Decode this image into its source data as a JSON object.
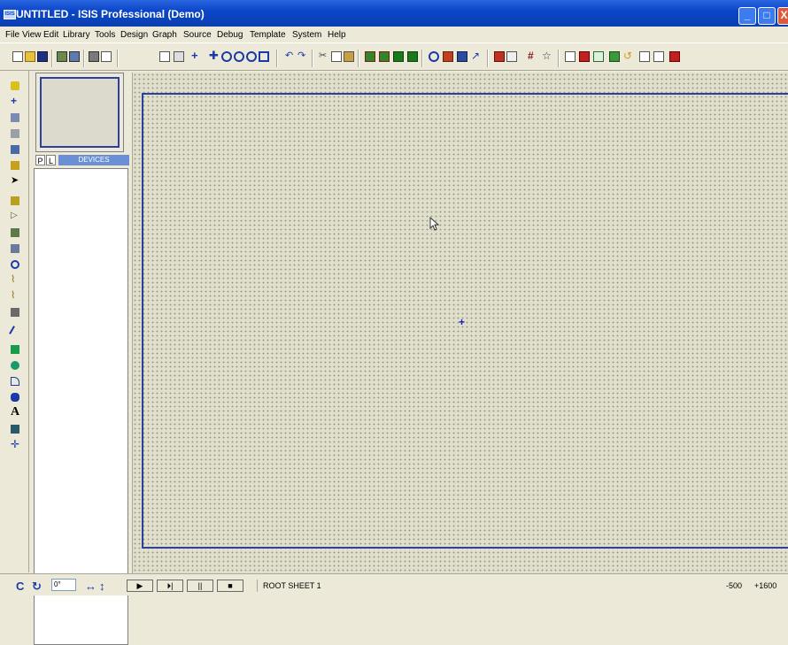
{
  "window": {
    "title": "UNTITLED - ISIS Professional (Demo)",
    "app_icon_text": "ISIS",
    "minimize": "_",
    "maximize": "□",
    "close": "X"
  },
  "menu": [
    "File",
    "View",
    "Edit",
    "Library",
    "Tools",
    "Design",
    "Graph",
    "Source",
    "Debug",
    "Template",
    "System",
    "Help"
  ],
  "devices_panel": {
    "pick_button": "P",
    "library_button": "L",
    "label": "DEVICES"
  },
  "canvas": {
    "origin_marker": "+"
  },
  "status": {
    "angle_value": "0°",
    "sim_buttons": [
      "▶",
      "⏵|",
      "||",
      "■"
    ],
    "sheet_name": "ROOT SHEET 1",
    "coord_x": "-500",
    "coord_y": "+1600"
  },
  "colors": {
    "titlebar": "#0a46c8",
    "sheet_border": "#2e3f9c",
    "devices_header": "#6b8fd4",
    "canvas_bg": "#e0dfcc"
  }
}
